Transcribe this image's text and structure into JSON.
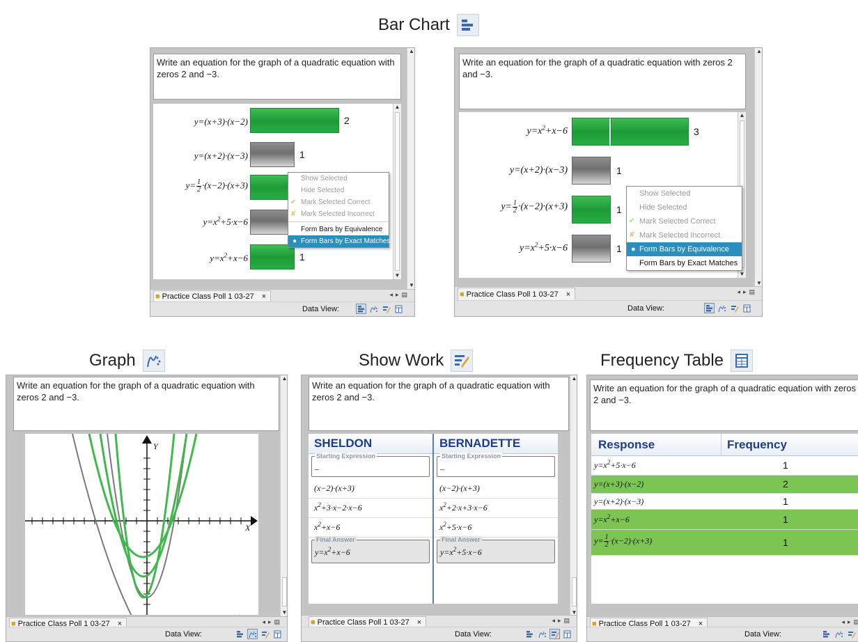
{
  "captions": {
    "bar_chart": "Bar Chart",
    "graph": "Graph",
    "show_work": "Show Work",
    "frequency_table": "Frequency Table"
  },
  "question_text": "Write an equation for the graph of a quadratic equation with zeros 2 and −3.",
  "tab_label": "Practice Class Poll 1 03-27",
  "tab_close": "×",
  "data_view_label": "Data View:",
  "expressions": {
    "a": "y=(x+3)·(x−2)",
    "b": "y=(x+2)·(x−3)",
    "c_prefix": "y=",
    "c_suffix": "·(x−2)·(x+3)",
    "c_num": "1",
    "c_den": "2",
    "d_pre": "y=x",
    "d_exp": "2",
    "d_post": "+5·x−6",
    "e_pre": "y=x",
    "e_exp": "2",
    "e_post": "+x−6"
  },
  "bar_panel_1": {
    "values": [
      "2",
      "1",
      "",
      "",
      "1"
    ],
    "menu": [
      "Show Selected",
      "Hide Selected",
      "Mark Selected Correct",
      "Mark Selected Incorrect",
      "Form Bars by Equivalence",
      "Form Bars by Exact Matches"
    ],
    "menu_selected": 5
  },
  "bar_panel_2": {
    "values": [
      "3",
      "1",
      "1",
      "1"
    ],
    "menu": [
      "Show Selected",
      "Hide Selected",
      "Mark Selected Correct",
      "Mark Selected Incorrect",
      "Form Bars by Equivalence",
      "Form Bars by Exact Matches"
    ],
    "menu_selected": 4
  },
  "graph": {
    "y_axis_label": "Y",
    "x_axis_label": "X"
  },
  "show_work": {
    "students": [
      {
        "name": "SHELDON",
        "starting_legend": "Starting Expression",
        "starting_value": "–",
        "step1": "(x−2)·(x+3)",
        "step2_a": "x",
        "step2_exp": "2",
        "step2_b": "+3·x−2·x−6",
        "step3_a": "x",
        "step3_exp": "2",
        "step3_b": "+x−6",
        "final_legend": "Final Answer",
        "final_a": "y=x",
        "final_exp": "2",
        "final_b": "+x−6"
      },
      {
        "name": "BERNADETTE",
        "starting_legend": "Starting Expression",
        "starting_value": "–",
        "step1": "(x−2)·(x+3)",
        "step2_a": "x",
        "step2_exp": "2",
        "step2_b": "+2·x+3·x−6",
        "step3_a": "x",
        "step3_exp": "2",
        "step3_b": "+5·x−6",
        "final_legend": "Final Answer",
        "final_a": "y=x",
        "final_exp": "2",
        "final_b": "+5·x−6"
      }
    ]
  },
  "frequency_table": {
    "headers": [
      "Response",
      "Frequency"
    ],
    "frequencies": [
      "1",
      "2",
      "1",
      "1",
      "1"
    ]
  },
  "colors": {
    "green_bar": "#22a33c",
    "gray_bar": "#7a7a7a",
    "highlight_row": "#7cc552",
    "menu_selected": "#2a8ebf",
    "header_text": "#1c3d8f"
  }
}
